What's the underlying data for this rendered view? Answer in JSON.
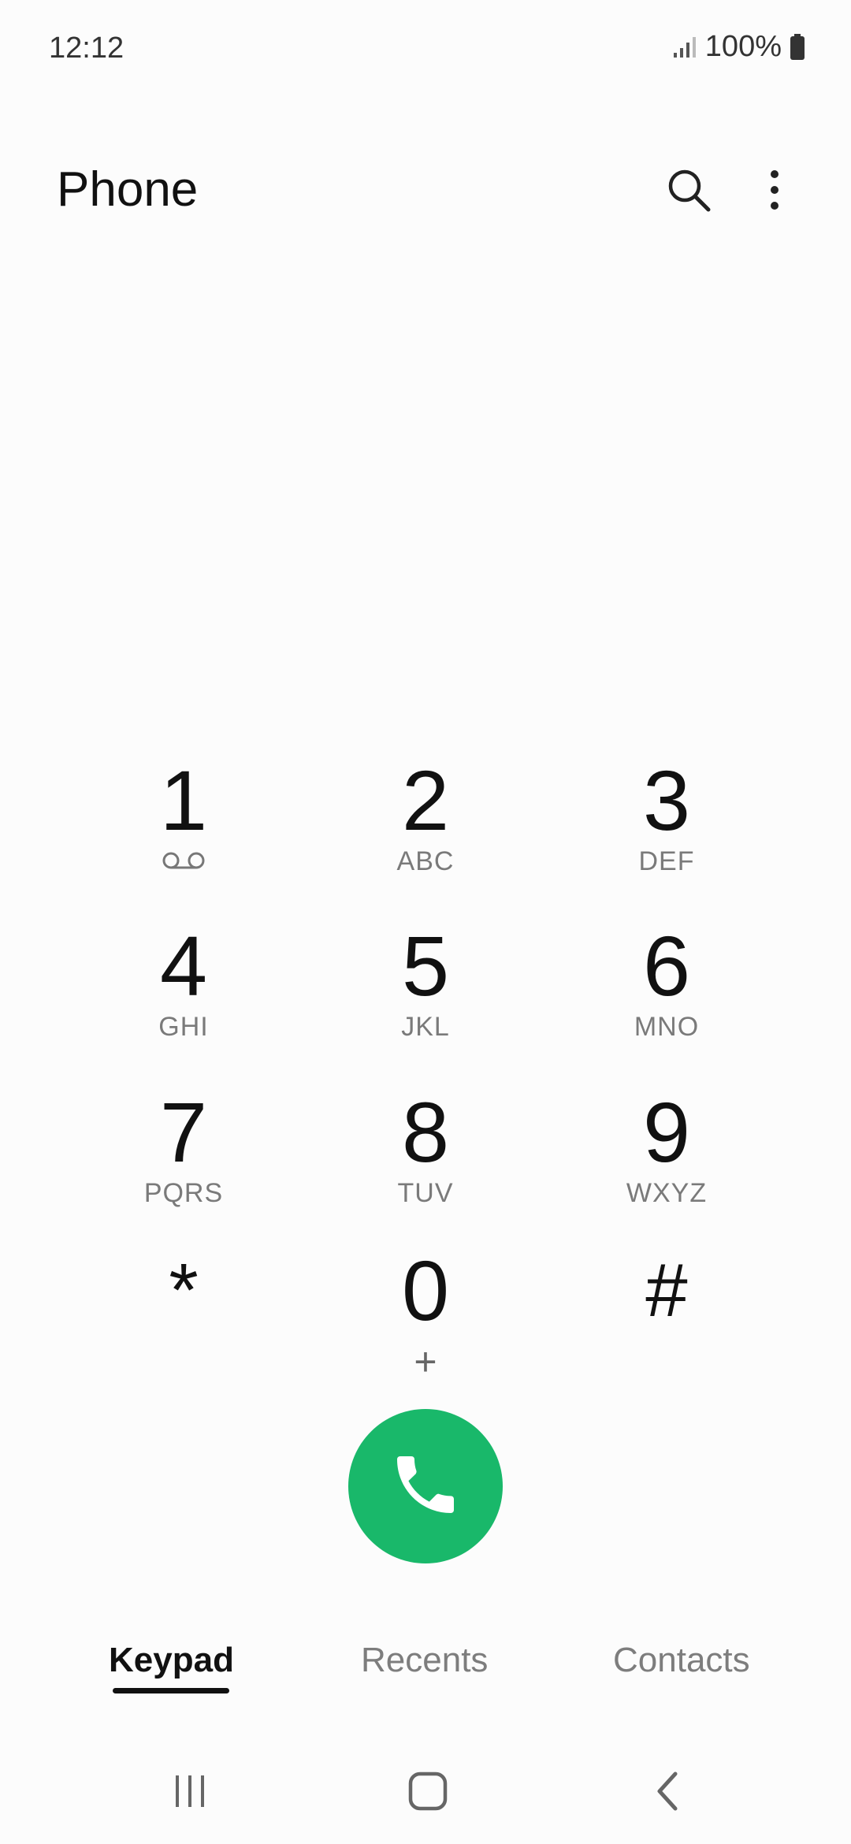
{
  "status_bar": {
    "time": "12:12",
    "battery": "100%"
  },
  "header": {
    "title": "Phone",
    "search_icon": "search-icon",
    "more_icon": "more-vertical-icon"
  },
  "keypad": {
    "keys": [
      {
        "digit": "1",
        "letters": "",
        "sub_icon": "voicemail-icon"
      },
      {
        "digit": "2",
        "letters": "ABC"
      },
      {
        "digit": "3",
        "letters": "DEF"
      },
      {
        "digit": "4",
        "letters": "GHI"
      },
      {
        "digit": "5",
        "letters": "JKL"
      },
      {
        "digit": "6",
        "letters": "MNO"
      },
      {
        "digit": "7",
        "letters": "PQRS"
      },
      {
        "digit": "8",
        "letters": "TUV"
      },
      {
        "digit": "9",
        "letters": "WXYZ"
      },
      {
        "digit": "*",
        "letters": ""
      },
      {
        "digit": "0",
        "letters": "+"
      },
      {
        "digit": "#",
        "letters": ""
      }
    ]
  },
  "call_button": {
    "icon": "phone-call-icon",
    "color": "#19b86a"
  },
  "tabs": [
    {
      "label": "Keypad",
      "active": true
    },
    {
      "label": "Recents",
      "active": false
    },
    {
      "label": "Contacts",
      "active": false
    }
  ],
  "nav_bar": {
    "recents_icon": "recent-apps-icon",
    "home_icon": "home-icon",
    "back_icon": "back-icon"
  }
}
